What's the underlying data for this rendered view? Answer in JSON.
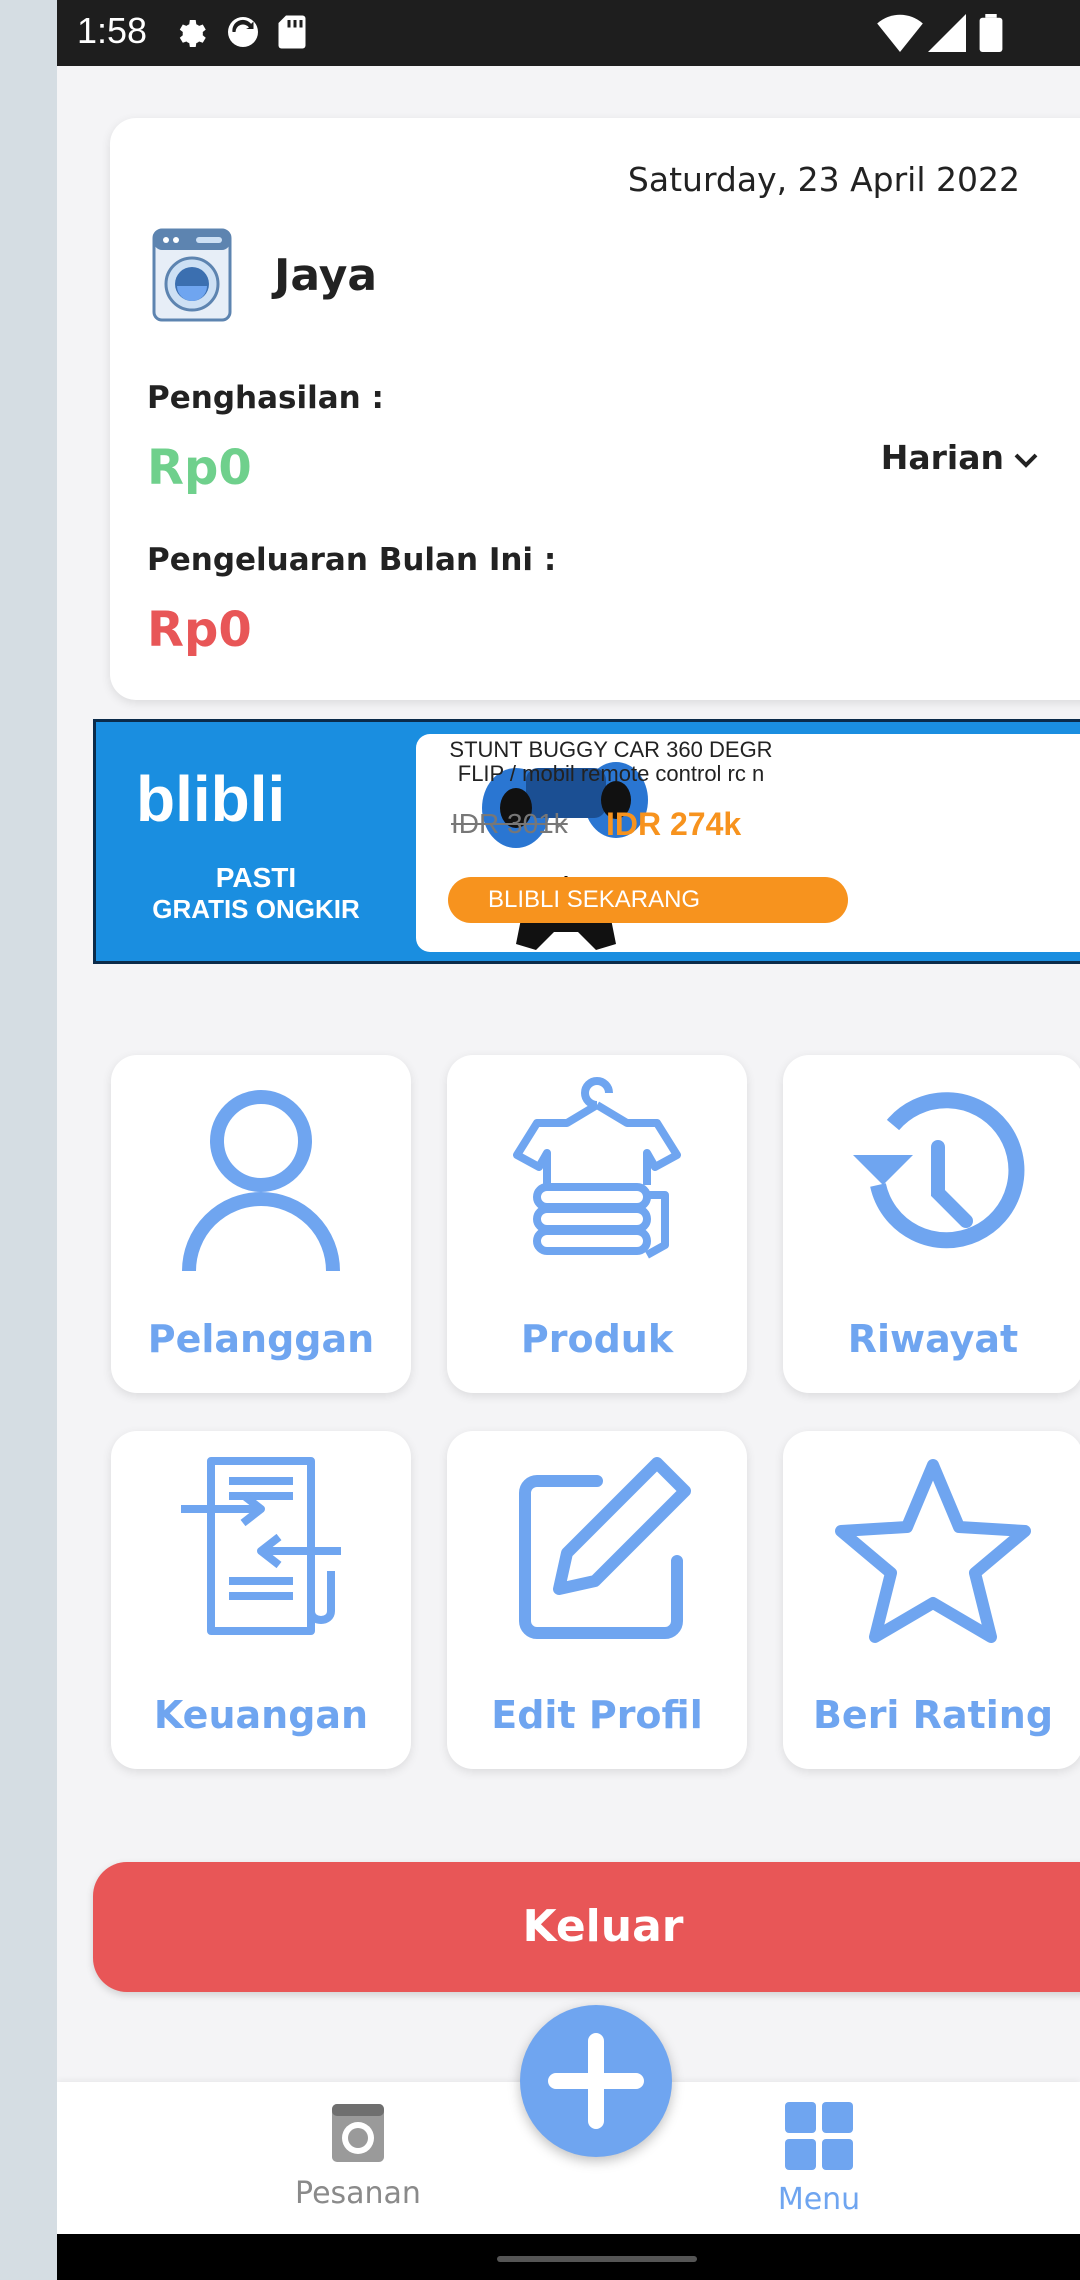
{
  "status_bar": {
    "time": "1:58"
  },
  "summary": {
    "date": "Saturday, 23 April 2022",
    "name": "Jaya",
    "income_label": "Penghasilan :",
    "income_value": "Rp0",
    "period": "Harian",
    "expense_label": "Pengeluaran Bulan Ini :",
    "expense_value": "Rp0",
    "income_color": "#6fd08c",
    "expense_color": "#e85657"
  },
  "ad": {
    "brand": "blibli",
    "tag_line1": "PASTI",
    "tag_line2": "GRATIS ONGKIR",
    "title_line1": "STUNT BUGGY CAR 360 DEGR",
    "title_line2": "FLIP / mobil remote control rc n",
    "old_price": "IDR 301k",
    "new_price": "IDR 274k",
    "cta": "BLIBLI SEKARANG"
  },
  "menu": [
    {
      "label": "Pelanggan",
      "icon": "user-icon"
    },
    {
      "label": "Produk",
      "icon": "clothes-icon"
    },
    {
      "label": "Riwayat",
      "icon": "history-icon"
    },
    {
      "label": "Keuangan",
      "icon": "transfer-document-icon"
    },
    {
      "label": "Edit Profil",
      "icon": "edit-icon"
    },
    {
      "label": "Beri Rating",
      "icon": "star-icon"
    }
  ],
  "logout_label": "Keluar",
  "bottom_nav": {
    "left_label": "Pesanan",
    "right_label": "Menu",
    "active_color": "#6fa5f0",
    "inactive_color": "#8a8a8a"
  }
}
